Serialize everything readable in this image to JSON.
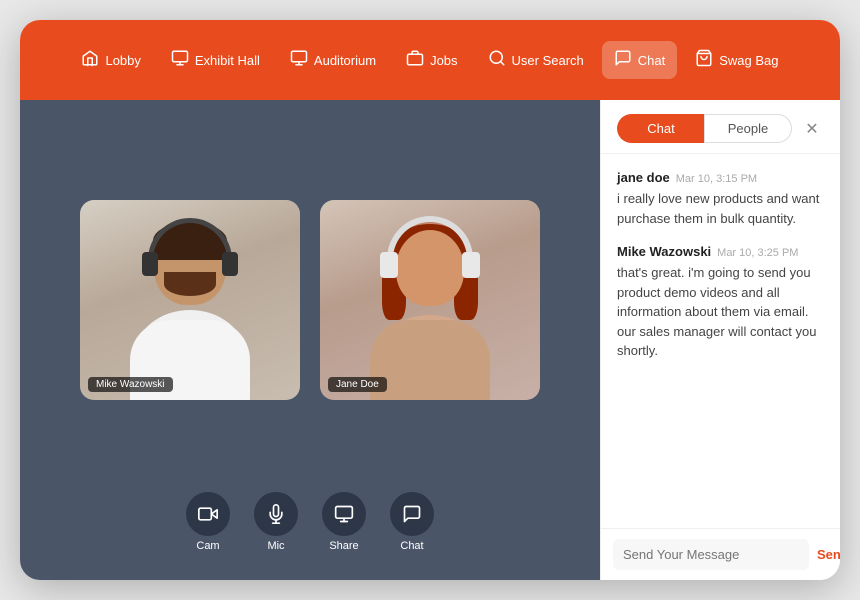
{
  "nav": {
    "items": [
      {
        "id": "lobby",
        "label": "Lobby",
        "icon": "🏠",
        "active": false
      },
      {
        "id": "exhibit-hall",
        "label": "Exhibit Hall",
        "icon": "🖥",
        "active": false
      },
      {
        "id": "auditorium",
        "label": "Auditorium",
        "icon": "🖥",
        "active": false
      },
      {
        "id": "jobs",
        "label": "Jobs",
        "icon": "💼",
        "active": false
      },
      {
        "id": "user-search",
        "label": "User Search",
        "icon": "🔍",
        "active": false
      },
      {
        "id": "chat",
        "label": "Chat",
        "icon": "💬",
        "active": true
      },
      {
        "id": "swag-bag",
        "label": "Swag Bag",
        "icon": "🎁",
        "active": false
      }
    ]
  },
  "video": {
    "participants": [
      {
        "id": "mike",
        "name": "Mike Wazowski"
      },
      {
        "id": "jane",
        "name": "Jane Doe"
      }
    ],
    "controls": [
      {
        "id": "cam",
        "label": "Cam"
      },
      {
        "id": "mic",
        "label": "Mic"
      },
      {
        "id": "share",
        "label": "Share"
      },
      {
        "id": "chat",
        "label": "Chat"
      }
    ]
  },
  "chat_panel": {
    "tabs": [
      {
        "id": "chat",
        "label": "Chat",
        "active": true
      },
      {
        "id": "people",
        "label": "People",
        "active": false
      }
    ],
    "messages": [
      {
        "sender": "jane doe",
        "time": "Mar 10, 3:15 PM",
        "text": "i really love new products and want purchase them in bulk quantity."
      },
      {
        "sender": "Mike Wazowski",
        "time": "Mar 10, 3:25 PM",
        "text": "that's great. i'm going to send you product demo videos and all information about them via email. our sales manager will contact you shortly."
      }
    ],
    "input_placeholder": "Send Your Message",
    "send_label": "Send"
  }
}
